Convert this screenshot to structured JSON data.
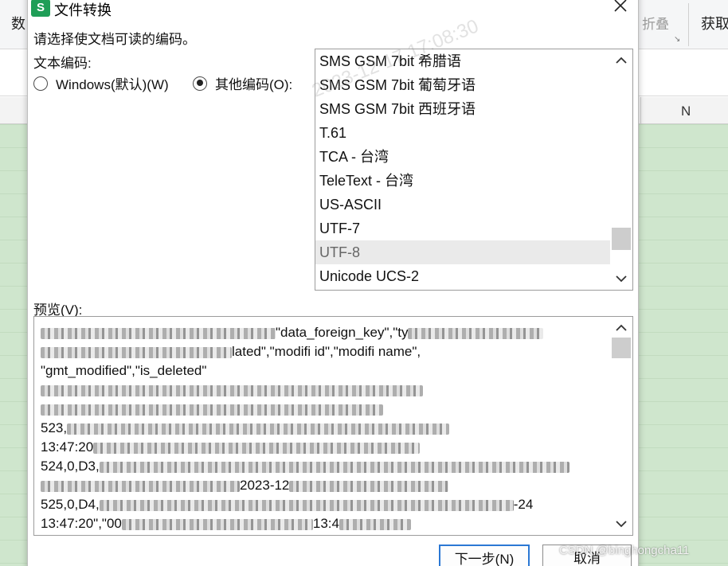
{
  "background": {
    "ribbon_left": "数",
    "fold_label": "折叠",
    "get_label": "获取",
    "column_header": "N"
  },
  "dialog": {
    "title": "文件转换",
    "app_icon_letter": "S",
    "instruction": "请选择使文档可读的编码。",
    "encoding_label": "文本编码:",
    "radio_windows": "Windows(默认)(W)",
    "radio_other": "其他编码(O):",
    "radio_selected": "other",
    "encodings": [
      "SMS GSM 7bit 希腊语",
      "SMS GSM 7bit 葡萄牙语",
      "SMS GSM 7bit 西班牙语",
      "T.61",
      "TCA - 台湾",
      "TeleText - 台湾",
      "US-ASCII",
      "UTF-7",
      "UTF-8",
      "Unicode UCS-2"
    ],
    "selected_encoding": "UTF-8",
    "preview_label": "预览(V):",
    "preview_lines": [
      "\"data_foreign_key\",\"ty",
      "lated\",\"modifi  id\",\"modifi  name\",",
      "\"gmt_modified\",\"is_deleted\"",
      "",
      "",
      "523,",
      "13:47:20",
      "524,0,D3,",
      "2023-12",
      "525,0,D4,",
      "13:47:20\",\"00"
    ],
    "preview_tail_line10": "-24",
    "preview_tail_line11": "13:4",
    "next_button": "下一步(N)",
    "cancel_button": "取消"
  },
  "watermark_text": "2023-12-17 17:08:30",
  "credit": "CSDN @binghongcha11",
  "colors": {
    "sheet_green": "#cfe6cd",
    "selection_gray": "#eaeaea",
    "primary_border": "#2b78d4",
    "app_icon": "#1f9e57"
  }
}
